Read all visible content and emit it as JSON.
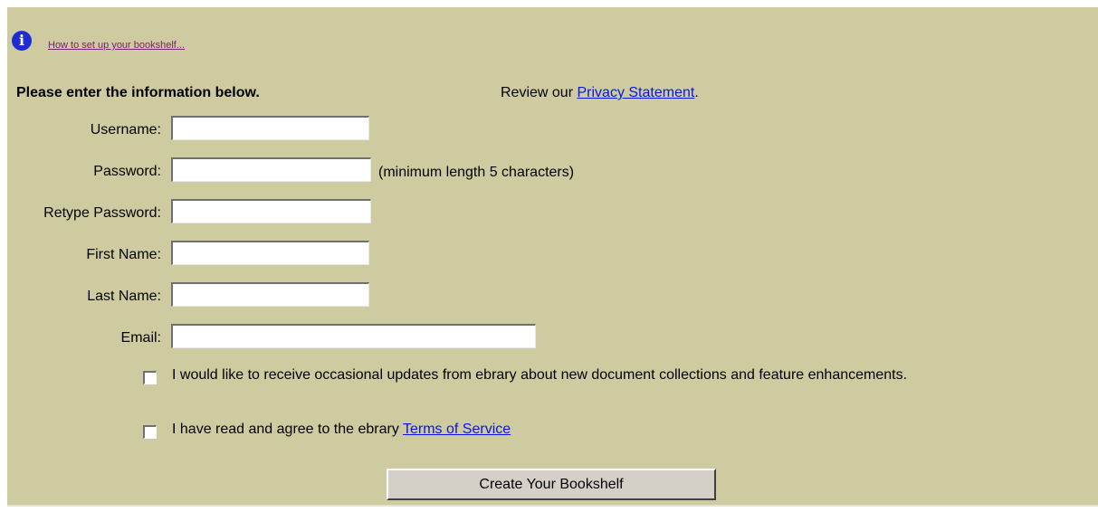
{
  "help": {
    "icon": "info-icon",
    "link_text": "How to set up your bookshelf..."
  },
  "form": {
    "heading": "Please enter the information below.",
    "privacy_prefix": "Review our ",
    "privacy_link": "Privacy Statement",
    "privacy_suffix": ".",
    "fields": {
      "username": {
        "label": "Username:",
        "value": ""
      },
      "password": {
        "label": "Password:",
        "value": "",
        "hint": "(minimum length 5 characters)"
      },
      "retype_password": {
        "label": "Retype Password:",
        "value": ""
      },
      "first_name": {
        "label": "First Name:",
        "value": ""
      },
      "last_name": {
        "label": "Last Name:",
        "value": ""
      },
      "email": {
        "label": "Email:",
        "value": ""
      }
    },
    "updates_checkbox": {
      "checked": false,
      "label": "I would like to receive occasional updates from ebrary about new document collections and feature enhancements."
    },
    "terms_checkbox": {
      "checked": false,
      "label_prefix": "I have read and agree to the ebrary ",
      "link": "Terms of Service"
    },
    "submit_label": "Create Your Bookshelf"
  },
  "colors": {
    "panel_background": "#cdcb9f",
    "link": "#0c16dd",
    "visited_link": "#7a2077",
    "info_icon": "#1e2bd1"
  }
}
